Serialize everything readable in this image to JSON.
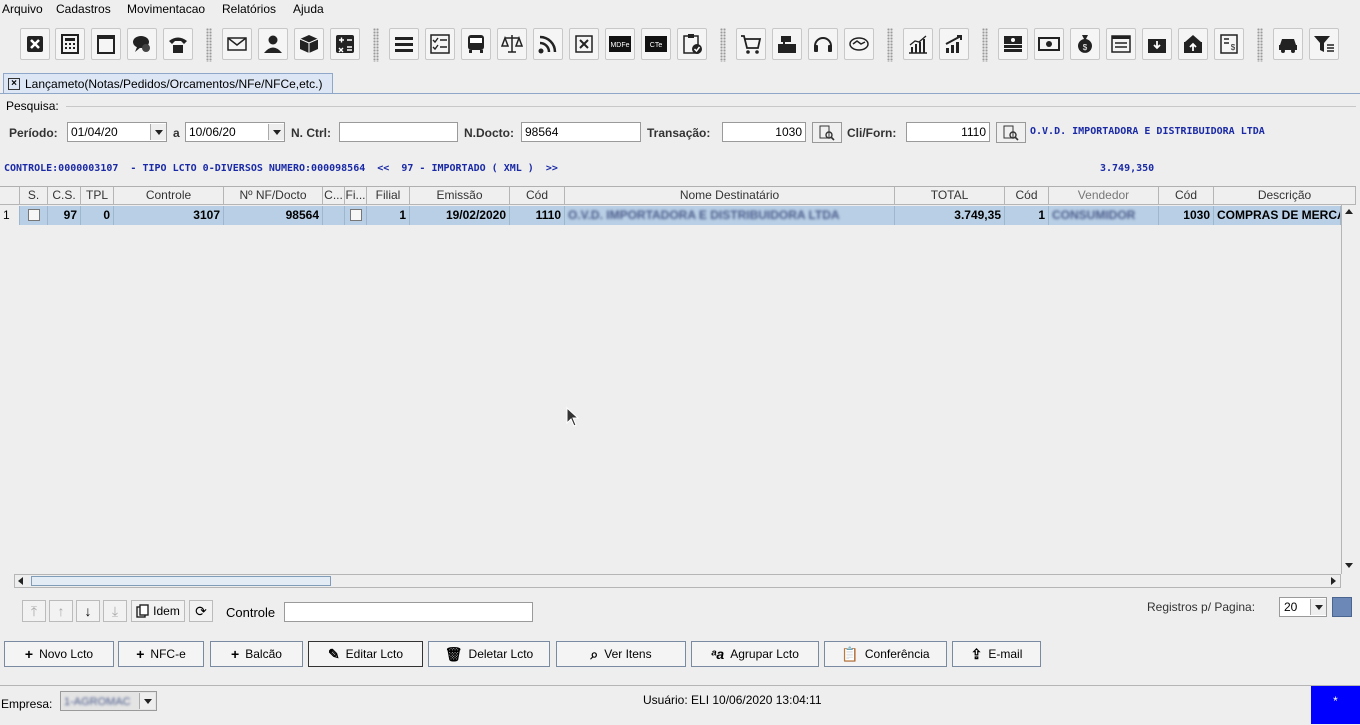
{
  "menu": [
    "Arquivo",
    "Cadastros",
    "Movimentacao",
    "Relatórios",
    "Ajuda"
  ],
  "tab": {
    "title": "Lançameto(Notas/Pedidos/Orcamentos/NFe/NFCe,etc.)"
  },
  "search": {
    "legend": "Pesquisa:",
    "periodo_label": "Período:",
    "periodo_de": "01/04/20",
    "a_label": "a",
    "periodo_ate": "10/06/20",
    "nctrl_label": "N. Ctrl:",
    "nctrl_value": "",
    "ndocto_label": "N.Docto:",
    "ndocto_value": "98564",
    "transacao_label": "Transação:",
    "transacao_value": "1030",
    "cliforn_label": "Cli/Forn:",
    "cliforn_value": "1110",
    "cliforn_name": "O.V.D. IMPORTADORA E DISTRIBUIDORA LTDA"
  },
  "infoline": {
    "text": "CONTROLE:0000003107  - TIPO LCTO 0-DIVERSOS NUMERO:000098564  <<  97 - IMPORTADO ( XML )  >>",
    "total": "3.749,350"
  },
  "table": {
    "headers": [
      "S.",
      "C.S.",
      "TPL",
      "Controle",
      "Nº NF/Docto",
      "C...",
      "Fi...",
      "Filial",
      "Emissão",
      "Cód",
      "Nome Destinatário",
      "TOTAL",
      "Cód",
      "Vendedor",
      "Cód",
      "Descrição"
    ],
    "row": {
      "num": "1",
      "cs": "97",
      "tpl": "0",
      "controle": "3107",
      "nf": "98564",
      "filial": "1",
      "emissao": "19/02/2020",
      "cod": "1110",
      "nome": "O.V.D. IMPORTADORA E DISTRIBUIDORA LTDA",
      "total": "3.749,35",
      "cod2": "1",
      "vendedor": "CONSUMIDOR",
      "cod3": "1030",
      "descricao": "COMPRAS DE MERCADORIAS"
    }
  },
  "nav": {
    "idem": "Idem",
    "controle_label": "Controle",
    "controle_value": "",
    "registros_label": "Registros p/ Pagina:",
    "registros_value": "20"
  },
  "actions": [
    "Novo Lcto",
    "NFC-e",
    "Balcão",
    "Editar Lcto",
    "Deletar Lcto",
    "Ver Itens",
    "Agrupar Lcto",
    "Conferência",
    "E-mail"
  ],
  "status": {
    "empresa_label": "Empresa:",
    "empresa_value": "1-AGROMAC",
    "usuario": "Usuário: ELI 10/06/2020 13:04:11",
    "indicator": "*"
  }
}
